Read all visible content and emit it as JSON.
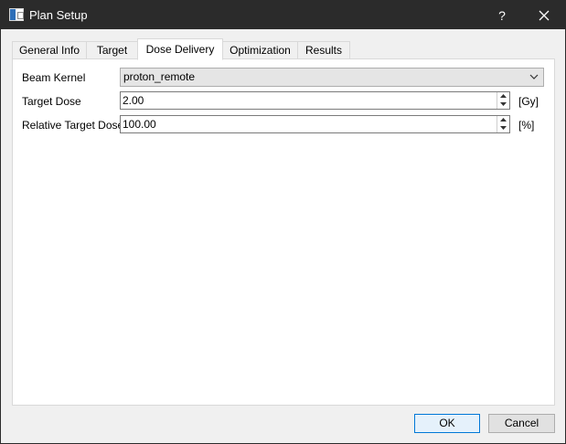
{
  "window": {
    "title": "Plan Setup",
    "help_label": "?"
  },
  "icons": {
    "app": "app-window-icon",
    "close": "close-icon",
    "combo_arrow": "chevron-down-icon",
    "spin_up": "caret-up-icon",
    "spin_down": "caret-down-icon"
  },
  "tabs": [
    {
      "label": "General Info"
    },
    {
      "label": "Target"
    },
    {
      "label": "Dose Delivery",
      "active": true
    },
    {
      "label": "Optimization"
    },
    {
      "label": "Results"
    }
  ],
  "form": {
    "beam_kernel": {
      "label": "Beam Kernel",
      "value": "proton_remote"
    },
    "target_dose": {
      "label": "Target Dose",
      "value": "2.00",
      "unit": "[Gy]"
    },
    "relative_target_dose": {
      "label": "Relative Target Dose",
      "value": "100.00",
      "unit": "[%]"
    }
  },
  "buttons": {
    "ok": "OK",
    "cancel": "Cancel"
  },
  "colors": {
    "titlebar": "#2b2b2b",
    "accent": "#0078d7",
    "panel": "#ffffff",
    "window_bg": "#f0f0f0"
  }
}
